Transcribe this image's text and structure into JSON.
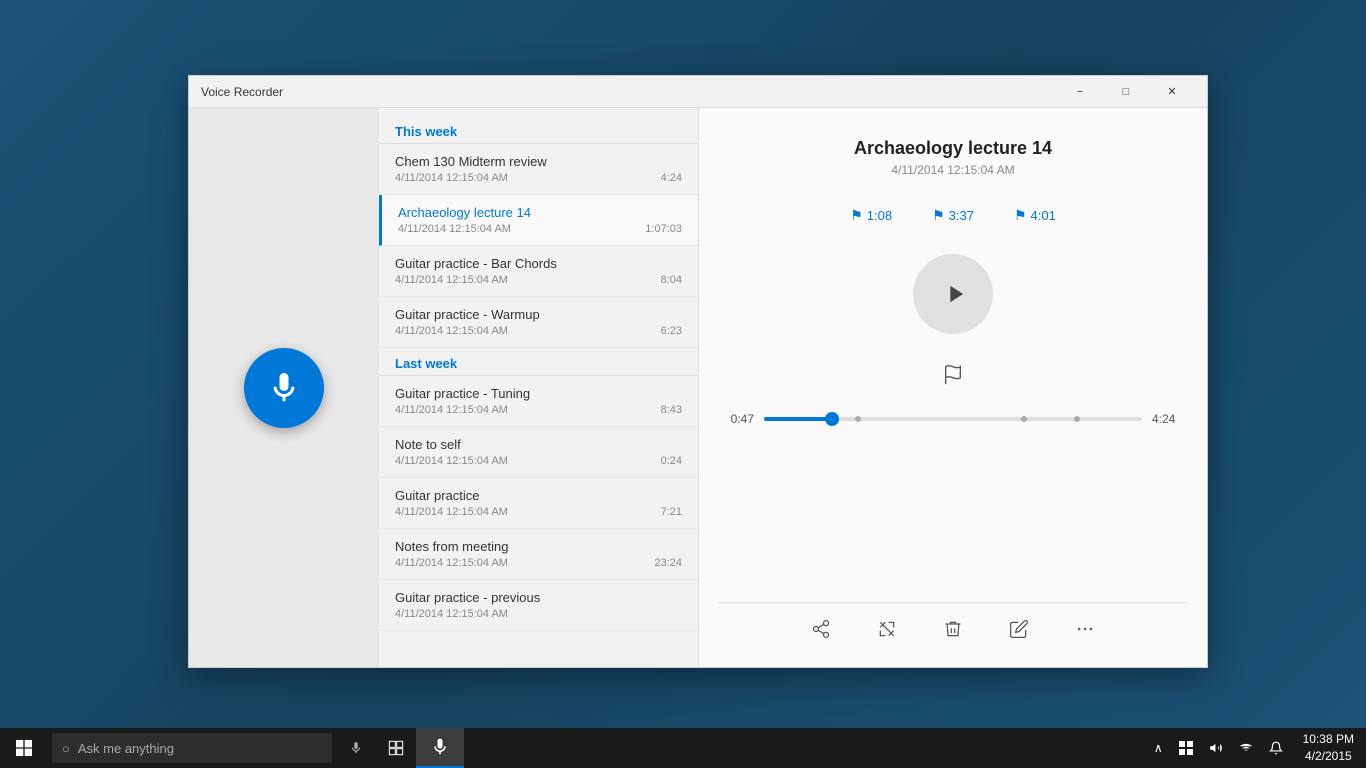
{
  "window": {
    "title": "Voice Recorder",
    "minimize_label": "−",
    "maximize_label": "□",
    "close_label": "✕"
  },
  "sections": {
    "this_week": "This week",
    "last_week": "Last week"
  },
  "recordings": [
    {
      "id": "chem130",
      "name": "Chem 130 Midterm review",
      "date": "4/11/2014 12:15:04 AM",
      "duration": "4:24",
      "active": false,
      "section": "this_week"
    },
    {
      "id": "archaeology",
      "name": "Archaeology lecture 14",
      "date": "4/11/2014 12:15:04 AM",
      "duration": "1:07:03",
      "active": true,
      "section": "this_week"
    },
    {
      "id": "guitar-bar",
      "name": "Guitar practice - Bar Chords",
      "date": "4/11/2014 12:15:04 AM",
      "duration": "8:04",
      "active": false,
      "section": "this_week"
    },
    {
      "id": "guitar-warmup",
      "name": "Guitar practice - Warmup",
      "date": "4/11/2014 12:15:04 AM",
      "duration": "6:23",
      "active": false,
      "section": "this_week"
    },
    {
      "id": "guitar-tuning",
      "name": "Guitar practice - Tuning",
      "date": "4/11/2014 12:15:04 AM",
      "duration": "8:43",
      "active": false,
      "section": "last_week"
    },
    {
      "id": "note-to-self",
      "name": "Note to self",
      "date": "4/11/2014 12:15:04 AM",
      "duration": "0:24",
      "active": false,
      "section": "last_week"
    },
    {
      "id": "guitar-practice",
      "name": "Guitar practice",
      "date": "4/11/2014 12:15:04 AM",
      "duration": "7:21",
      "active": false,
      "section": "last_week"
    },
    {
      "id": "notes-meeting",
      "name": "Notes from meeting",
      "date": "4/11/2014 12:15:04 AM",
      "duration": "23:24",
      "active": false,
      "section": "last_week"
    },
    {
      "id": "guitar-previous",
      "name": "Guitar practice - previous",
      "date": "4/11/2014 12:15:04 AM",
      "duration": "",
      "active": false,
      "section": "last_week"
    }
  ],
  "player": {
    "title": "Archaeology lecture 14",
    "date": "4/11/2014 12:15:04 AM",
    "markers": [
      {
        "time": "1:08"
      },
      {
        "time": "3:37"
      },
      {
        "time": "4:01"
      }
    ],
    "current_time": "0:47",
    "total_time": "4:24",
    "progress_percent": 18
  },
  "toolbar": {
    "share_title": "Share",
    "trim_title": "Trim",
    "delete_title": "Delete",
    "rename_title": "Rename",
    "more_title": "More"
  },
  "taskbar": {
    "search_placeholder": "Ask me anything",
    "time": "10:38 PM",
    "date": "4/2/2015"
  }
}
